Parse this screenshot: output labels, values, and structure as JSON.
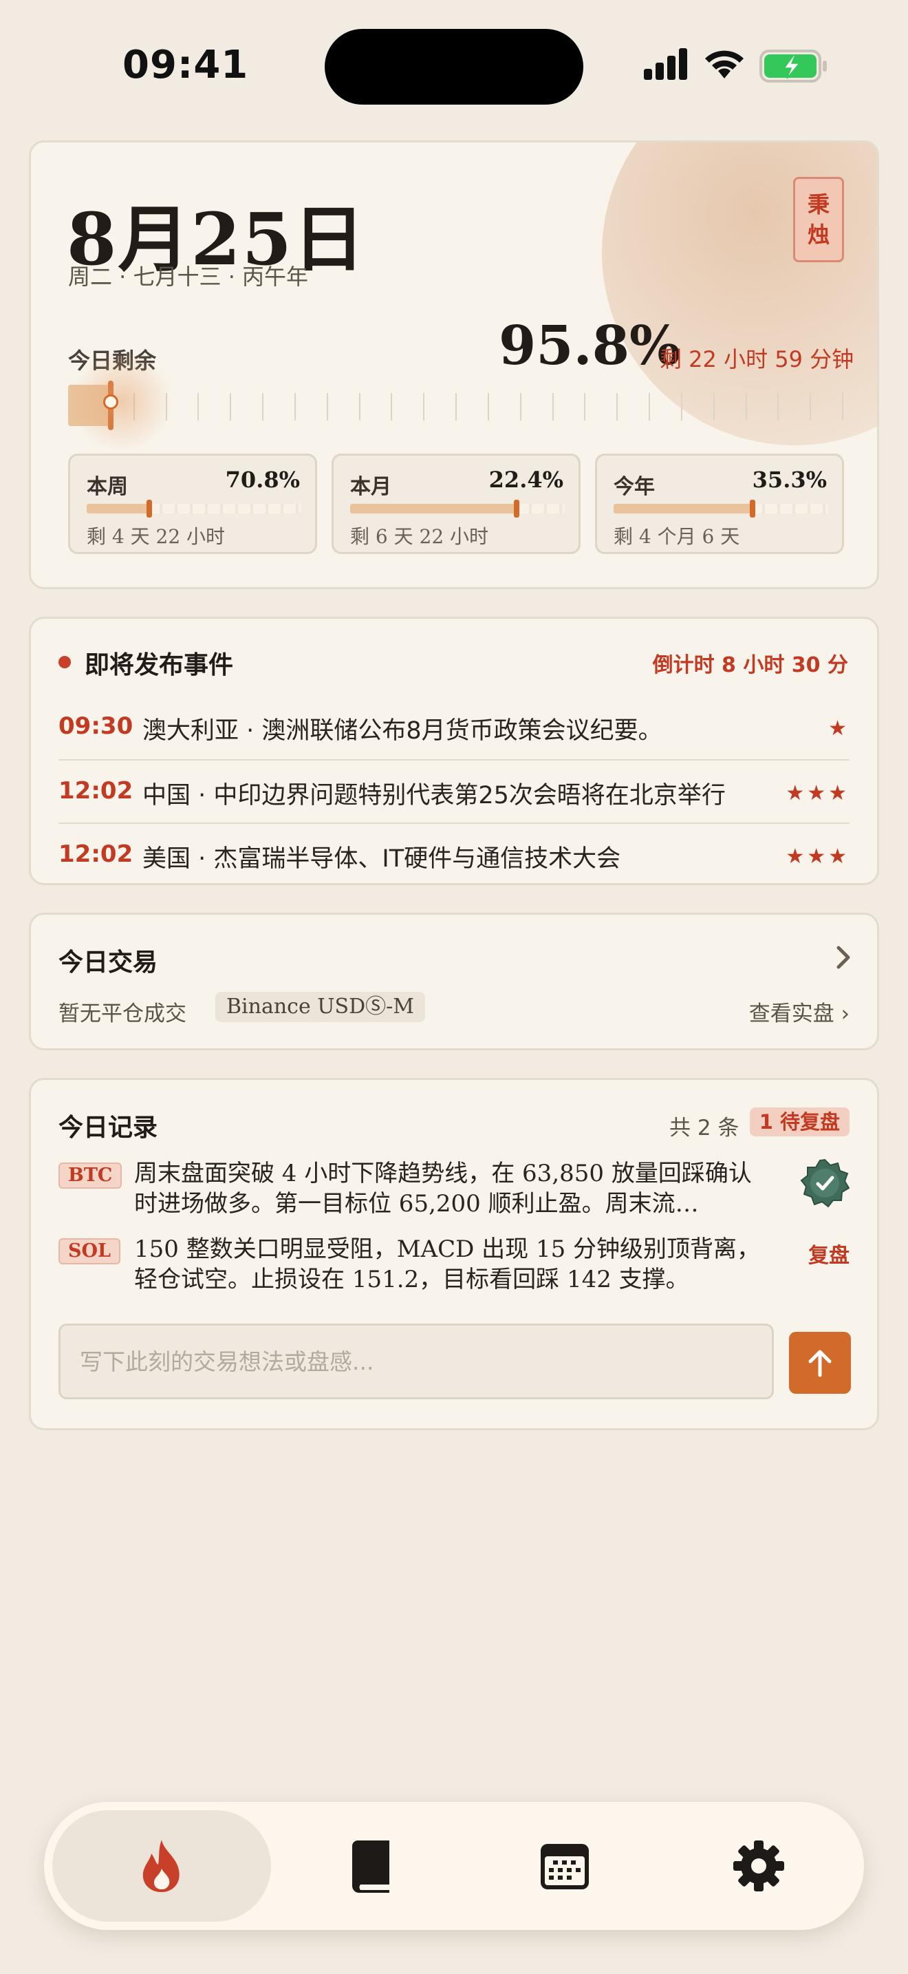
{
  "status_bar": {
    "time": "09:41"
  },
  "date_card": {
    "date": "8月25日",
    "subtitle": "周二 · 七月十三 · 丙午年",
    "seal": "秉烛",
    "remain_label": "今日剩余",
    "percent": "95.8%",
    "remain_time": "剩 22 小时 59 分钟",
    "day_progress_elapsed": 0.042,
    "periods": [
      {
        "label": "本周",
        "percent": "70.8%",
        "remain": "剩 4 天 22 小时",
        "elapsed": 0.292
      },
      {
        "label": "本月",
        "percent": "22.4%",
        "remain": "剩 6 天 22 小时",
        "elapsed": 0.776
      },
      {
        "label": "今年",
        "percent": "35.3%",
        "remain": "剩 4 个月 6 天",
        "elapsed": 0.647
      }
    ]
  },
  "events": {
    "title": "即将发布事件",
    "countdown": "倒计时 8 小时 30 分",
    "items": [
      {
        "time": "09:30",
        "text": "澳大利亚 · 澳洲联储公布8月货币政策会议纪要。",
        "stars": "★"
      },
      {
        "time": "12:02",
        "text": "中国 · 中印边界问题特别代表第25次会晤将在北京举行",
        "stars": "★★★"
      },
      {
        "time": "12:02",
        "text": "美国 · 杰富瑞半导体、IT硬件与通信技术大会",
        "stars": "★★★"
      }
    ]
  },
  "trade": {
    "title": "今日交易",
    "empty_text": "暂无平仓成交",
    "exchange": "Binance USDⓈ-M",
    "view_link": "查看实盘 ›"
  },
  "records": {
    "title": "今日记录",
    "count": "共 2 条",
    "pending": "1 待复盘",
    "items": [
      {
        "tag": "BTC",
        "text": "周末盘面突破 4 小时下降趋势线，在 63,850 放量回踩确认时进场做多。第一目标位 65,200 顺利止盈。周末流…",
        "action": ""
      },
      {
        "tag": "SOL",
        "text": "150 整数关口明显受阻，MACD 出现 15 分钟级别顶背离，轻仓试空。止损设在 151.2，目标看回踩 142 支撑。",
        "action": "复盘"
      }
    ],
    "input_placeholder": "写下此刻的交易想法或盘感..."
  },
  "tab_bar": {
    "tabs": [
      {
        "icon": "flame-icon",
        "active": true
      },
      {
        "icon": "book-icon",
        "active": false
      },
      {
        "icon": "calendar-icon",
        "active": false
      },
      {
        "icon": "gear-icon",
        "active": false
      }
    ]
  },
  "colors": {
    "accent": "#c23a22",
    "orange": "#d26a2a",
    "background": "#f1ebe2",
    "card": "#f8f4ec"
  }
}
